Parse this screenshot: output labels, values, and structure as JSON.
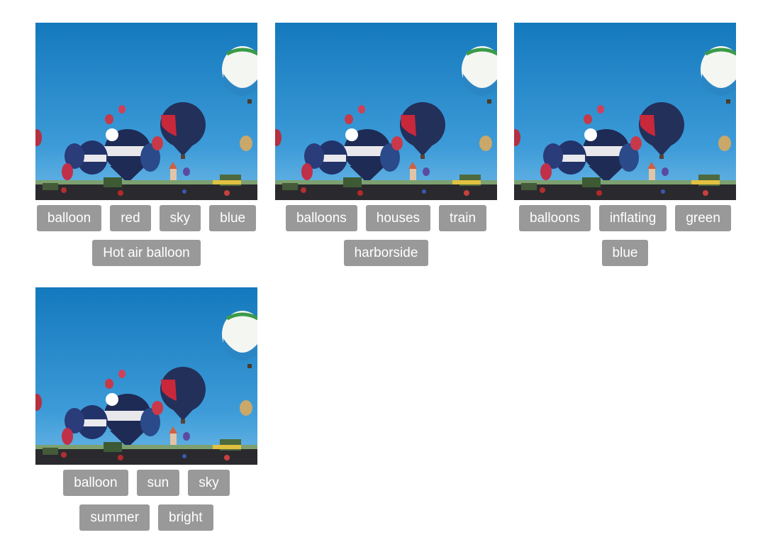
{
  "gallery": {
    "items": [
      {
        "image": "hot-air-balloon-festival-photo",
        "tags": [
          "balloon",
          "red",
          "sky",
          "blue",
          "Hot air balloon"
        ]
      },
      {
        "image": "hot-air-balloon-festival-photo",
        "tags": [
          "balloons",
          "houses",
          "train",
          "harborside"
        ]
      },
      {
        "image": "hot-air-balloon-festival-photo",
        "tags": [
          "balloons",
          "inflating",
          "green",
          "blue"
        ]
      },
      {
        "image": "hot-air-balloon-festival-photo",
        "tags": [
          "balloon",
          "sun",
          "sky",
          "summer",
          "bright"
        ]
      }
    ]
  },
  "colors": {
    "tag_background": "#999999",
    "tag_text": "#ffffff",
    "sky_top": "#1a7fc1",
    "sky_bottom": "#5aaee0"
  }
}
